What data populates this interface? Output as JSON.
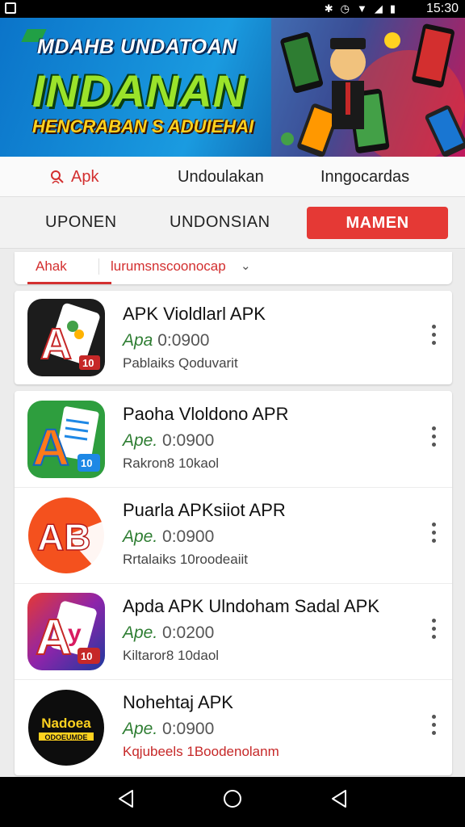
{
  "status_bar": {
    "time": "15:30",
    "icons": [
      "bluetooth-icon",
      "alarm-icon",
      "wifi-icon",
      "signal-icon",
      "battery-icon"
    ]
  },
  "banner": {
    "line1": "MDAHB UNDATOAN",
    "line2": "INDANAN",
    "line3": "HENCRABAN S ADUIEHAI"
  },
  "top_tabs": [
    {
      "label": "Apk",
      "icon": "search-person-icon",
      "active": true
    },
    {
      "label": "Undoulakan",
      "active": false
    },
    {
      "label": "Inngocardas",
      "active": false
    }
  ],
  "sub_tabs": [
    {
      "label": "UPONEN",
      "selected": false
    },
    {
      "label": "UNDONSIAN",
      "selected": false
    },
    {
      "label": "MAMEN",
      "selected": true
    }
  ],
  "filter": {
    "left_label": "Ahak",
    "right_label": "lurumsnscoonocap",
    "chevron": "chevron-down-icon"
  },
  "apps": [
    {
      "title": "APK Violdlarl APK",
      "version_prefix": "Apa",
      "version": "0:0900",
      "subtitle": "Pablaiks Qoduvarit",
      "subtitle_color": "#444444",
      "icon": "a-card-app-icon"
    },
    {
      "title": "Paoha Vloldono APR",
      "version_prefix": "Ape.",
      "version": "0:0900",
      "subtitle": "Rakron8 10kaol",
      "subtitle_color": "#444444",
      "icon": "a-doc-app-icon"
    },
    {
      "title": "Puarla APKsiiot APR",
      "version_prefix": "Ape.",
      "version": "0:0900",
      "subtitle": "Rrtalaiks 10roodeaiit",
      "subtitle_color": "#444444",
      "icon": "ab-circle-app-icon"
    },
    {
      "title": "Apda APK Ulndoham Sadal APK",
      "version_prefix": "Ape.",
      "version": "0:0200",
      "subtitle": "Kiltaror8 10daol",
      "subtitle_color": "#444444",
      "icon": "a-gradient-app-icon"
    },
    {
      "title": "Nohehtaj APK",
      "version_prefix": "Ape.",
      "version": "0:0900",
      "subtitle": "Kqjubeels 1Boodenolanm",
      "subtitle_color": "#c62828",
      "icon": "nadoea-app-icon"
    }
  ],
  "nav": {
    "back": "back-icon",
    "home": "home-icon",
    "recents": "recents-icon"
  },
  "colors": {
    "accent": "#e53935",
    "text": "#111111",
    "banner_green": "#9be32a",
    "banner_yellow": "#ffd21f"
  }
}
